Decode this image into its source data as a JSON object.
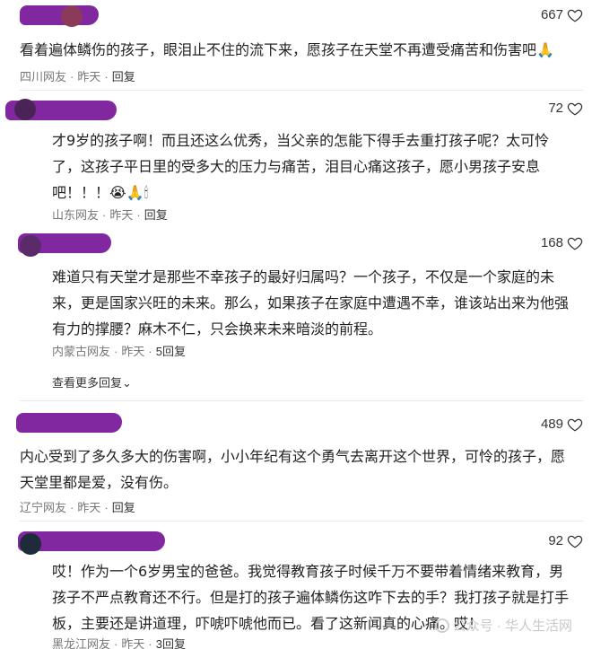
{
  "comments": [
    {
      "likes": "667",
      "text": "看着遍体鳞伤的孩子，眼泪止不住的流下来，愿孩子在天堂不再遭受痛苦和伤害吧🙏",
      "region": "四川网友",
      "time": "昨天",
      "reply": "回复"
    },
    {
      "likes": "72",
      "text": "才9岁的孩子啊！而且还这么优秀，当父亲的怎能下得手去重打孩子呢？太可怜了，这孩子平日里的受多大的压力与痛苦，泪目心痛这孩子，愿小男孩子安息吧！！！😭🙏🕯",
      "region": "山东网友",
      "time": "昨天",
      "reply": "回复"
    },
    {
      "likes": "168",
      "text": "难道只有天堂才是那些不幸孩子的最好归属吗？一个孩子，不仅是一个家庭的未来，更是国家兴旺的未来。那么，如果孩子在家庭中遭遇不幸，谁该站出来为他强有力的撑腰？麻木不仁，只会换来未来暗淡的前程。",
      "region": "内蒙古网友",
      "time": "昨天",
      "reply": "5回复",
      "more": "查看更多回复"
    },
    {
      "likes": "489",
      "text": "内心受到了多久多大的伤害啊，小小年纪有这个勇气去离开这个世界，可怜的孩子，愿天堂里都是爱，没有伤。",
      "region": "辽宁网友",
      "time": "昨天",
      "reply": "回复"
    },
    {
      "likes": "92",
      "text": "哎！作为一个6岁男宝的爸爸。我觉得教育孩子时候千万不要带着情绪来教育，男孩子不严点教育还不行。但是打的孩子遍体鳞伤这咋下去的手？我打孩子就是打手板，主要还是讲道理，吓唬吓唬他而已。看了这新闻真的心痛。哎！",
      "region": "黑龙江网友",
      "time": "昨天",
      "reply": "3回复"
    }
  ],
  "watermark": "公众号 · 华人生活网",
  "colors": {
    "redaction": "#7a1b9a",
    "meta": "#777777"
  }
}
